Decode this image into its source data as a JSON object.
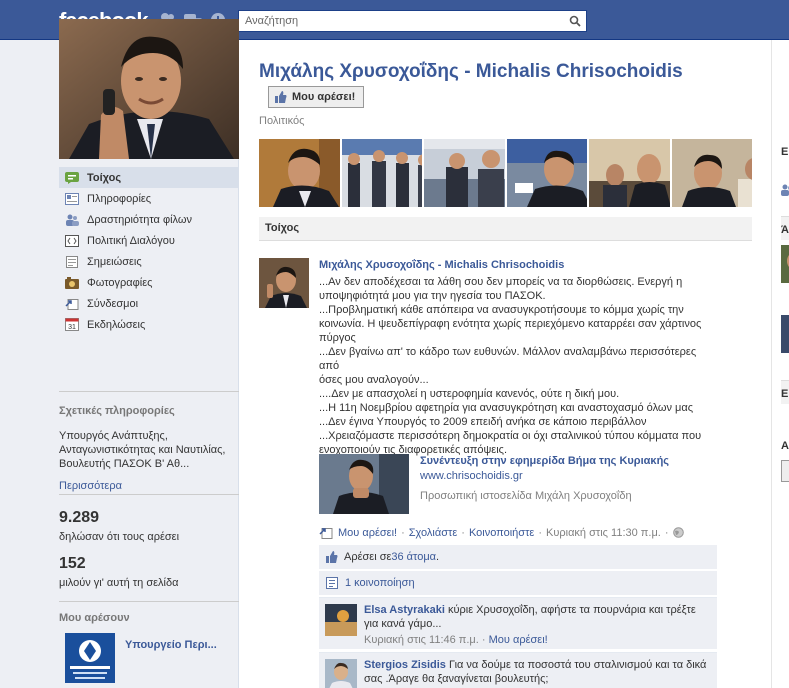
{
  "topbar": {
    "logo": "facebook",
    "search_placeholder": "Αναζήτηση"
  },
  "left": {
    "nav": [
      {
        "label": "Τοίχος",
        "icon": "wall-icon",
        "active": true
      },
      {
        "label": "Πληροφορίες",
        "icon": "info-icon"
      },
      {
        "label": "Δραστηριότητα φίλων",
        "icon": "friends-activity-icon"
      },
      {
        "label": "Πολιτική Διαλόγου",
        "icon": "dialogue-policy-icon"
      },
      {
        "label": "Σημειώσεις",
        "icon": "notes-icon"
      },
      {
        "label": "Φωτογραφίες",
        "icon": "photos-icon"
      },
      {
        "label": "Σύνδεσμοι",
        "icon": "links-icon"
      },
      {
        "label": "Εκδηλώσεις",
        "icon": "events-icon"
      }
    ],
    "info_heading": "Σχετικές πληροφορίες",
    "info_text": "Υπουργός Ανάπτυξης, Ανταγωνιστικότητας και Ναυτιλίας, Βουλευτής ΠΑΣΟΚ Β' Αθ...",
    "more_link": "Περισσότερα",
    "likes_count": "9.289",
    "likes_label": "δηλώσαν ότι τους αρέσει",
    "talking_count": "152",
    "talking_label": "μιλούν γι' αυτή τη σελίδα",
    "liked_heading": "Μου αρέσουν",
    "liked_page": "Υπουργείο Περι..."
  },
  "main": {
    "title": "Μιχάλης Χρυσοχοΐδης - Michalis Chrisochoidis",
    "like_button": "Μου αρέσει!",
    "category": "Πολιτικός",
    "wall_header": "Τοίχος",
    "post": {
      "author": "Μιχάλης Χρυσοχοΐδης - Michalis Chrisochoidis",
      "lines": [
        "...Αν δεν αποδέχεσαι τα λάθη σου δεν μπορείς να τα διορθώσεις. Ενεργή η",
        "υποψηφιότητά μου για την ηγεσία του ΠΑΣΟΚ.",
        "...Προβληματική κάθε απόπειρα να ανασυγκροτήσουμε το κόμμα χωρίς την",
        "κοινωνία. Η ψευδεπίγραφη ενότητα χωρίς περιεχόμενο καταρρέει σαν χάρτινος",
        "πύργος",
        "...Δεν βγαίνω απ' το κάδρο των ευθυνών. Μάλλον αναλαμβάνω περισσότερες από",
        "όσες μου αναλογούν...",
        "....Δεν με απασχολεί η υστεροφημία κανενός, ούτε η δική μου.",
        "...Η 11η Νοεμβρίου αφετηρία για ανασυγκρότηση και αναστοχασμό όλων μας",
        "...Δεν έγινα Υπουργός το 2009 επειδή ανήκα σε κάποιο περιβάλλον",
        "...Χρειαζόμαστε περισσότερη δημοκρατία οι όχι σταλινικού τύπου κόμματα που",
        "ενοχοποιούν τις διαφορετικές απόψεις."
      ],
      "attachment": {
        "title": "Συνέντευξη στην εφημερίδα Βήμα της Κυριακής",
        "url": "www.chrisochoidis.gr",
        "description": "Προσωπική ιστοσελίδα Μιχάλη Χρυσοχοΐδη"
      },
      "actions": {
        "like": "Μου αρέσει!",
        "comment": "Σχολιάστε",
        "share": "Κοινοποιήστε",
        "timestamp": "Κυριακή στις 11:30 π.μ."
      },
      "likes_prefix": "Αρέσει σε ",
      "likes_link": "36 άτομα",
      "likes_suffix": ".",
      "shares": "1 κοινοποίηση",
      "comments": [
        {
          "author": "Elsa Astyrakaki",
          "text": "κύριε Χρυσοχοΐδη, αφήστε τα πουρνάρια και τρέξτε για κανά γάμο...",
          "time": "Κυριακή στις 11:46 π.μ.",
          "like": "Μου αρέσει!"
        },
        {
          "author": "Stergios Zisidis",
          "text": "Για να δούμε τα ποσοστά του σταλινισμού και τα δικά σας .Άραγε θα ξαναγίνεται βουλευτής;"
        }
      ]
    }
  },
  "right": {
    "headings": [
      "Ε",
      "Ά",
      "Ει",
      "Α"
    ]
  }
}
